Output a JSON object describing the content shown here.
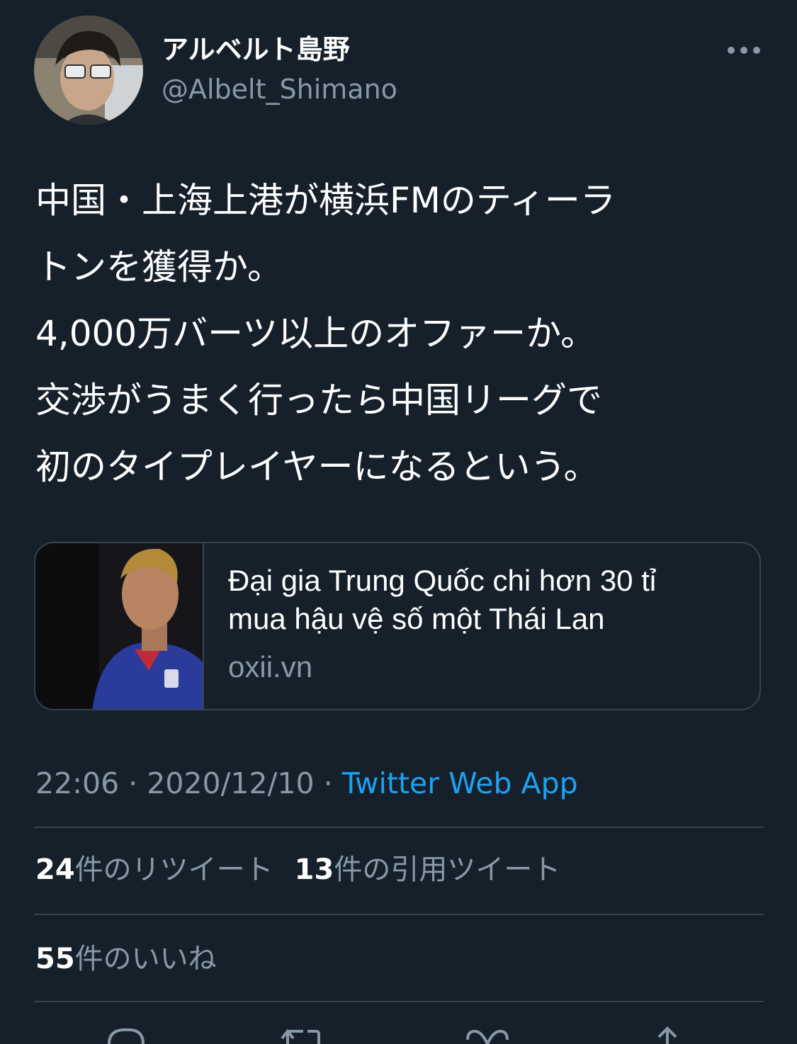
{
  "author": {
    "display_name": "アルベルト島野",
    "handle": "@Albelt_Shimano"
  },
  "more_icon": "more-horizontal-icon",
  "tweet": {
    "lines": [
      "中国・上海上港が横浜FMのティーラ",
      "トンを獲得か。",
      "4,000万バーツ以上のオファーか。",
      "交渉がうまく行ったら中国リーグで",
      "初のタイプレイヤーになるという。"
    ]
  },
  "card": {
    "title_lines": [
      "Đại gia Trung Quốc chi hơn 30 tỉ",
      "mua hậu vệ số một Thái Lan"
    ],
    "domain": "oxii.vn"
  },
  "meta": {
    "time": "22:06",
    "separator": " · ",
    "date": "2020/12/10",
    "source": "Twitter Web App"
  },
  "stats": {
    "retweets_count": "24",
    "retweets_label": "件のリツイート",
    "quotes_count": "13",
    "quotes_label": "件の引用ツイート",
    "likes_count": "55",
    "likes_label": "件のいいね"
  },
  "actions": [
    "reply-icon",
    "retweet-icon",
    "like-icon",
    "share-icon"
  ],
  "colors": {
    "background": "#15202b",
    "text": "#ffffff",
    "secondary": "#8899a6",
    "accent": "#1da1f2",
    "border": "#38444d"
  }
}
